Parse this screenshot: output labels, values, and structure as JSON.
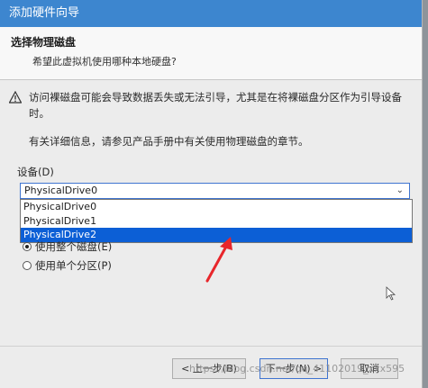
{
  "window": {
    "title": "添加硬件向导"
  },
  "header": {
    "title": "选择物理磁盘",
    "subtitle": "希望此虚拟机使用哪种本地硬盘?"
  },
  "warning": {
    "icon": "warning-icon",
    "text": "访问裸磁盘可能会导致数据丢失或无法引导，尤其是在将裸磁盘分区作为引导设备时。"
  },
  "info": "有关详细信息，请参见产品手册中有关使用物理磁盘的章节。",
  "device": {
    "label": "设备(D)",
    "selected": "PhysicalDrive0",
    "options": [
      "PhysicalDrive0",
      "PhysicalDrive1",
      "PhysicalDrive2"
    ],
    "highlighted_index": 2
  },
  "usage": {
    "whole_disk": "使用整个磁盘(E)",
    "single_partition": "使用单个分区(P)",
    "selected": "whole_disk"
  },
  "buttons": {
    "back": "< 上一步(B)",
    "next": "下一步(N) >",
    "cancel": "取消"
  },
  "watermark": "https://blog.csdn.net/qq_41102019_xxx595",
  "colors": {
    "titlebar": "#3d86cf",
    "selection": "#0c5fd6",
    "annotation_arrow": "#e8262b"
  }
}
